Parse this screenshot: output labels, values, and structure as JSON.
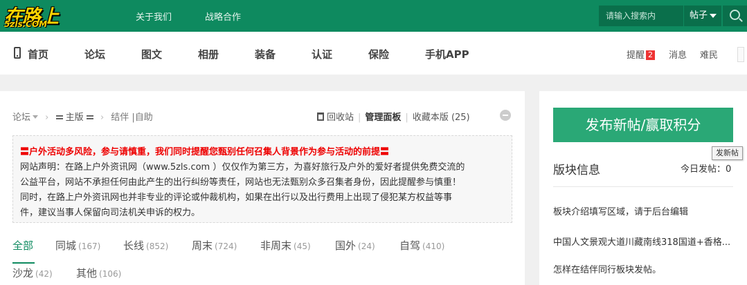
{
  "header": {
    "logo_main": "在路上",
    "logo_sub": "5zls.COM",
    "links": [
      "关于我们",
      "战略合作"
    ],
    "search_placeholder": "请输入搜索内",
    "search_type": "帖子"
  },
  "nav": {
    "items": [
      "首页",
      "论坛",
      "图文",
      "相册",
      "装备",
      "认证",
      "保险",
      "手机APP"
    ],
    "remind_label": "提醒",
    "remind_count": "2",
    "message_label": "消息",
    "user_name": "难民"
  },
  "breadcrumb": {
    "forum": "论坛",
    "main": "主版",
    "current": "结伴 |自助"
  },
  "tools": {
    "recycle": "回收站",
    "manage": "管理面板",
    "favorite": "收藏本版 (25)"
  },
  "notice": {
    "warning": "〓户外活动多风险，参与请慎重，我们同时提醒您甄别任何召集人背景作为参与活动的前提〓",
    "lines": [
      "网站声明：在路上户外资讯网（www.5zls.com ）仅仅作为第三方，为喜好旅行及户外的爱好者提供免费交流的",
      "公益平台，网站不承担任何由此产生的出行纠纷等责任，网站也无法甄别众多召集者身份，因此提醒参与慎重！",
      "同时，在路上户外资讯网也并非专业的评论或仲裁机构，如果在出行以及出行费用上出现了侵犯某方权益等事",
      "件，建议当事人保留向司法机关申诉的权力。"
    ]
  },
  "filters": [
    {
      "label": "全部",
      "count": ""
    },
    {
      "label": "同城",
      "count": "(167)"
    },
    {
      "label": "长线",
      "count": "(852)"
    },
    {
      "label": "周末",
      "count": "(724)"
    },
    {
      "label": "非周末",
      "count": "(45)"
    },
    {
      "label": "国外",
      "count": "(24)"
    },
    {
      "label": "自驾",
      "count": "(410)"
    },
    {
      "label": "沙龙",
      "count": "(42)"
    },
    {
      "label": "其他",
      "count": "(106)"
    }
  ],
  "sidebar": {
    "post_button": "发布新帖/赢取积分",
    "tooltip": "发新帖",
    "block_title": "版块信息",
    "today_posts": "今日发帖：0",
    "info": [
      "板块介绍填写区域，请于后台编辑",
      "中国人文景观大道川藏南线318国道+香格...",
      "怎样在结伴同行板块发帖。"
    ]
  },
  "colors": {
    "brand_green": "#0e8a5f",
    "button_green": "#2aa876",
    "warning_red": "#e00000",
    "logo_yellow": "#ffd400"
  }
}
